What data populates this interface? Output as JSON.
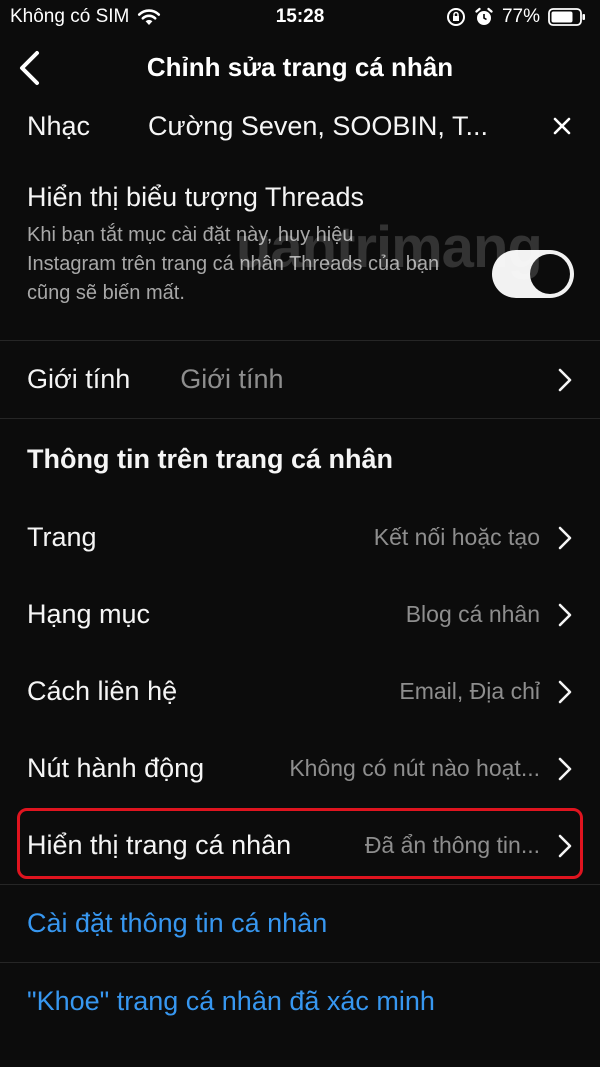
{
  "status": {
    "carrier": "Không có SIM",
    "time": "15:28",
    "battery": "77%"
  },
  "header": {
    "title": "Chỉnh sửa trang cá nhân"
  },
  "music": {
    "label": "Nhạc",
    "value": "Cường Seven, SOOBIN, T..."
  },
  "threads": {
    "title": "Hiển thị biểu tượng Threads",
    "description": "Khi bạn tắt mục cài đặt này, huy hiệu Instagram trên trang cá nhân Threads của bạn cũng sẽ biến mất.",
    "toggle_on": true
  },
  "gender": {
    "label": "Giới tính",
    "value": "Giới tính"
  },
  "section": {
    "title": "Thông tin trên trang cá nhân"
  },
  "rows": [
    {
      "label": "Trang",
      "value": "Kết nối hoặc tạo"
    },
    {
      "label": "Hạng mục",
      "value": "Blog cá nhân"
    },
    {
      "label": "Cách liên hệ",
      "value": "Email, Địa chỉ"
    },
    {
      "label": "Nút hành động",
      "value": "Không có nút nào hoạt..."
    },
    {
      "label": "Hiển thị trang cá nhân",
      "value": "Đã ẩn thông tin..."
    }
  ],
  "links": {
    "personal_info": "Cài đặt thông tin cá nhân",
    "verified": "\"Khoe\" trang cá nhân đã xác minh"
  },
  "watermark": "uantrimang",
  "colors": {
    "background": "#0c0c0c",
    "link": "#3797f0",
    "highlight": "#e0141f"
  }
}
